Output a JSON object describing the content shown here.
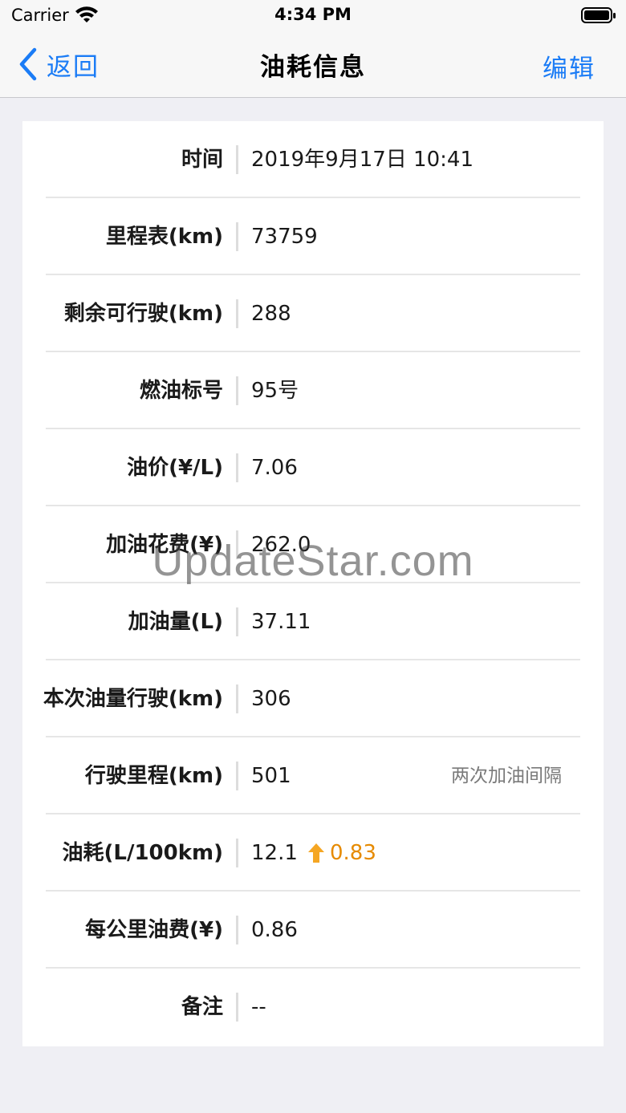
{
  "status_bar": {
    "carrier": "Carrier",
    "time": "4:34 PM",
    "icons": [
      "wifi-icon",
      "battery-icon"
    ]
  },
  "nav": {
    "back_label": "返回",
    "title": "油耗信息",
    "edit_label": "编辑",
    "back_icon": "chevron-left-icon",
    "accent_color": "#1b7cf6"
  },
  "rows": [
    {
      "label": "时间",
      "value": "2019年9月17日 10:41"
    },
    {
      "label": "里程表(km)",
      "value": "73759"
    },
    {
      "label": "剩余可行驶(km)",
      "value": "288"
    },
    {
      "label": "燃油标号",
      "value": "95号"
    },
    {
      "label": "油价(¥/L)",
      "value": "7.06"
    },
    {
      "label": "加油花费(¥)",
      "value": "262.0"
    },
    {
      "label": "加油量(L)",
      "value": "37.11"
    },
    {
      "label": "本次油量行驶(km)",
      "value": "306"
    },
    {
      "label": "行驶里程(km)",
      "value": "501",
      "note": "两次加油间隔"
    },
    {
      "label": "油耗(L/100km)",
      "value": "12.1",
      "trend": {
        "icon": "arrow-up-icon",
        "value": "0.83",
        "color": "#e68a00"
      }
    },
    {
      "label": "每公里油费(¥)",
      "value": "0.86"
    },
    {
      "label": "备注",
      "value": "--"
    }
  ],
  "watermark": "UpdateStar.com"
}
